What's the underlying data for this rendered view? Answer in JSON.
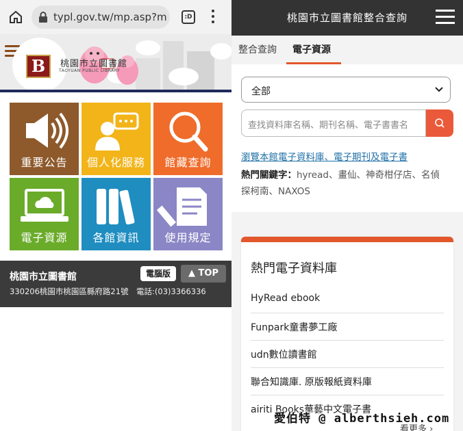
{
  "left_phone": {
    "browser": {
      "url": "typl.gov.tw/mp.asp?mp=",
      "tabs_glyph": ":D"
    },
    "banner": {
      "logo_letter": "B",
      "library_name_zh": "桃園市立圖書館",
      "library_name_en": "TAOYUAN PUBLIC LIBRARY"
    },
    "tiles": [
      {
        "label": "重要公告",
        "icon": "megaphone-icon",
        "color": "#8e5a2c"
      },
      {
        "label": "個人化服務",
        "icon": "person-chat-icon",
        "color": "#f2b419"
      },
      {
        "label": "館藏查詢",
        "icon": "magnifier-icon",
        "color": "#ef6c2b"
      },
      {
        "label": "電子資源",
        "icon": "laptop-cloud-icon",
        "color": "#6aab2a"
      },
      {
        "label": "各館資訊",
        "icon": "books-icon",
        "color": "#1f8dc0"
      },
      {
        "label": "使用規定",
        "icon": "document-pen-icon",
        "color": "#8b86c6"
      }
    ],
    "footer": {
      "name": "桃園市立圖書館",
      "address": "330206桃園市桃園區縣府路21號　電話:(03)3366336",
      "desktop_label": "電腦版",
      "top_label": "▲ TOP"
    }
  },
  "right_phone": {
    "header_title": "桃園市立圖書館整合查詢",
    "tabs": [
      {
        "label": "整合查詢",
        "active": false
      },
      {
        "label": "電子資源",
        "active": true
      }
    ],
    "accent": "#e2572b",
    "search": {
      "select_value": "全部",
      "placeholder": "查找資料庫名稱、期刊名稱、電子書書名",
      "browse_link": "瀏覽本館電子資料庫、電子期刊及電子書",
      "hot_keywords_label": "熱門關鍵字：",
      "hot_keywords": "hyread、畫仙、神奇柑仔店、名偵探柯南、NAXOS"
    },
    "hot_databases": {
      "title": "熱門電子資料庫",
      "items": [
        "HyRead ebook",
        "Funpark童書夢工廠",
        "udn數位讀書館",
        "聯合知識庫. 原版報紙資料庫",
        "airiti Books華藝中文電子書"
      ],
      "more_label": "看更多 ›"
    }
  },
  "watermark": "愛伯特 @ alberthsieh.com"
}
